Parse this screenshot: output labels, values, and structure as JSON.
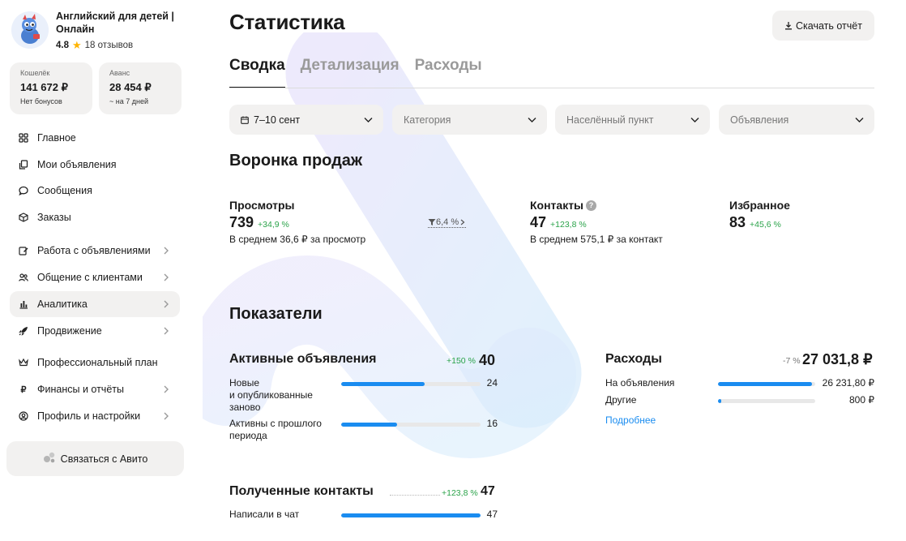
{
  "shop": {
    "name": "Английский для детей | Онлайн",
    "rating": "4.8",
    "reviews": "18 отзывов"
  },
  "wallet": {
    "label": "Кошелёк",
    "value": "141 672 ₽",
    "sub": "Нет бонусов"
  },
  "advance": {
    "label": "Аванс",
    "value": "28 454 ₽",
    "sub": "~ на 7 дней"
  },
  "sidebar": {
    "items": [
      {
        "label": "Главное",
        "icon": "grid-icon"
      },
      {
        "label": "Мои объявления",
        "icon": "copy-icon"
      },
      {
        "label": "Сообщения",
        "icon": "chat-icon"
      },
      {
        "label": "Заказы",
        "icon": "box-icon"
      },
      {
        "label": "Работа с объявлениями",
        "icon": "edit-icon"
      },
      {
        "label": "Общение с клиентами",
        "icon": "users-icon"
      },
      {
        "label": "Аналитика",
        "icon": "chart-icon"
      },
      {
        "label": "Продвижение",
        "icon": "rocket-icon"
      },
      {
        "label": "Профессиональный план",
        "icon": "crown-icon"
      },
      {
        "label": "Финансы и отчёты",
        "icon": "ruble-icon"
      },
      {
        "label": "Профиль и настройки",
        "icon": "user-gear-icon"
      }
    ],
    "contact_label": "Связаться с Авито"
  },
  "header": {
    "title": "Статистика",
    "download_label": "Скачать отчёт"
  },
  "tabs": [
    {
      "label": "Сводка"
    },
    {
      "label": "Детализация"
    },
    {
      "label": "Расходы"
    }
  ],
  "filters": {
    "date": "7–10 сент",
    "category": "Категория",
    "city": "Населённый пункт",
    "ads": "Объявления"
  },
  "funnel": {
    "title": "Воронка продаж",
    "views": {
      "title": "Просмотры",
      "value": "739",
      "delta": "+34,9 %",
      "avg": "В среднем 36,6 ₽ за просмотр"
    },
    "conversion": "6,4 %",
    "contacts": {
      "title": "Контакты",
      "value": "47",
      "delta": "+123,8 %",
      "avg": "В среднем 575,1 ₽ за контакт"
    },
    "favorites": {
      "title": "Избранное",
      "value": "83",
      "delta": "+45,6 %"
    }
  },
  "indicators": {
    "title": "Показатели",
    "active": {
      "title": "Активные объявления",
      "delta": "+150 %",
      "total": "40",
      "rows": [
        {
          "label": "Новые\nи опубликованные\nзаново",
          "value": "24",
          "fraction": 0.6
        },
        {
          "label": "Активны с прошлого\nпериода",
          "value": "16",
          "fraction": 0.4
        }
      ]
    },
    "expenses": {
      "title": "Расходы",
      "delta": "-7 %",
      "total": "27 031,8 ₽",
      "rows": [
        {
          "label": "На объявления",
          "value": "26 231,80 ₽",
          "fraction": 0.97
        },
        {
          "label": "Другие",
          "value": "800 ₽",
          "fraction": 0.03
        }
      ],
      "more_label": "Подробнее"
    },
    "contacts": {
      "title": "Полученные контакты",
      "delta": "+123,8 %",
      "total": "47",
      "rows": [
        {
          "label": "Написали в чат",
          "value": "47",
          "fraction": 1.0
        }
      ]
    }
  },
  "colors": {
    "accent": "#1a8cf0",
    "positive": "#2ba34a",
    "card": "#f2f1f0"
  }
}
